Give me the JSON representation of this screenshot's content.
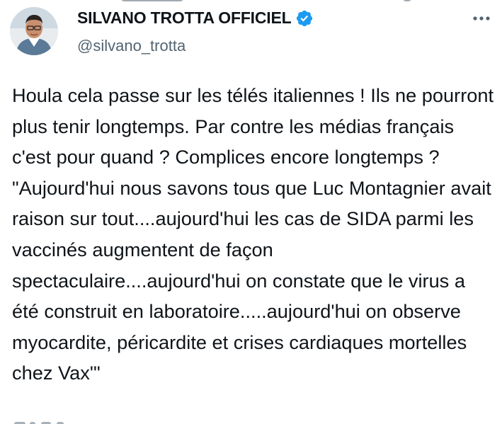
{
  "tweet": {
    "author": {
      "display_name": "SILVANO TROTTA OFFICIEL",
      "handle": "@silvano_trotta",
      "verified": true,
      "verified_color": "#1d9bf0"
    },
    "text": "Houla cela passe sur les télés italiennes ! Ils ne pourront plus tenir longtemps. Par contre les médias français c'est pour quand ? Complices encore longtemps ? \"Aujourd'hui nous savons tous que Luc Montagnier avait raison sur tout....aujourd'hui les cas de SIDA parmi les vaccinés augmentent de façon spectaculaire....aujourd'hui on constate que le virus a été construit en laboratoire.....aujourd'hui on observe myocardite, péricardite et crises cardiaques mortelles chez Vax'\"",
    "icons": {
      "more": "more-horizontal-icon",
      "verified": "verified-badge-icon"
    }
  },
  "colors": {
    "text_primary": "#0f1419",
    "text_secondary": "#536471",
    "accent": "#1d9bf0",
    "background": "#ffffff"
  }
}
